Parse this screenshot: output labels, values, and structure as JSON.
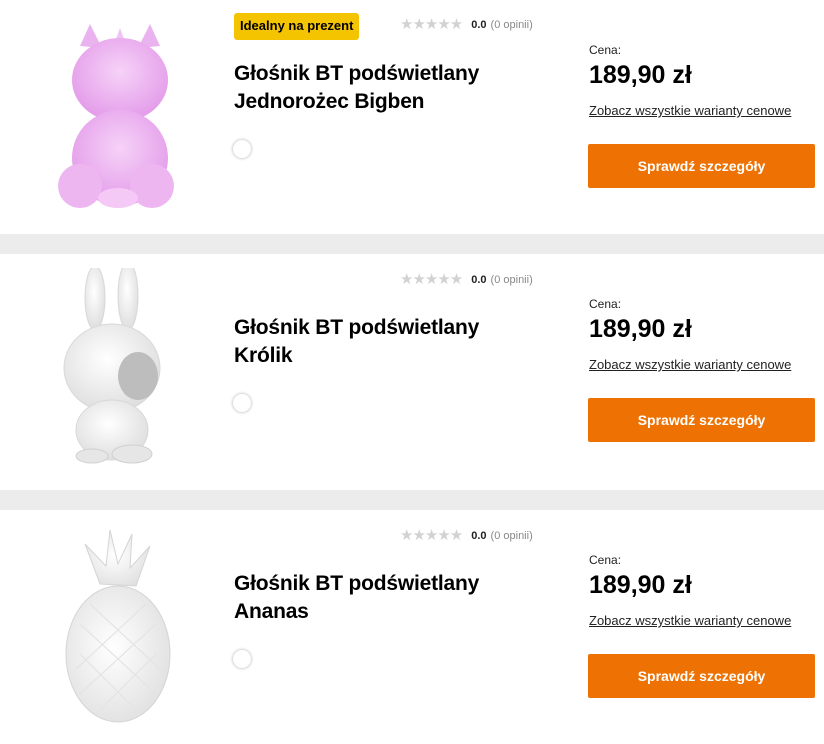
{
  "products": [
    {
      "badge": "Idealny na prezent",
      "rating_score": "0.0",
      "rating_count": "(0 opinii)",
      "title": "Głośnik BT podświetlany Jednorożec Bigben",
      "price_label": "Cena:",
      "price": "189,90 zł",
      "variants_link": "Zobacz wszystkie warianty cenowe",
      "cta": "Sprawdź szczegóły",
      "image_icon": "unicorn-lamp"
    },
    {
      "rating_score": "0.0",
      "rating_count": "(0 opinii)",
      "title": "Głośnik BT podświetlany Królik",
      "price_label": "Cena:",
      "price": "189,90 zł",
      "variants_link": "Zobacz wszystkie warianty cenowe",
      "cta": "Sprawdź szczegóły",
      "image_icon": "rabbit-lamp"
    },
    {
      "rating_score": "0.0",
      "rating_count": "(0 opinii)",
      "title": "Głośnik BT podświetlany Ananas",
      "price_label": "Cena:",
      "price": "189,90 zł",
      "variants_link": "Zobacz wszystkie warianty cenowe",
      "cta": "Sprawdź szczegóły",
      "image_icon": "pineapple-lamp"
    }
  ],
  "colors": {
    "accent_button": "#ee7203",
    "badge": "#f5c400",
    "separator": "#ececec",
    "unicorn_pink": "#e9a6f0"
  }
}
